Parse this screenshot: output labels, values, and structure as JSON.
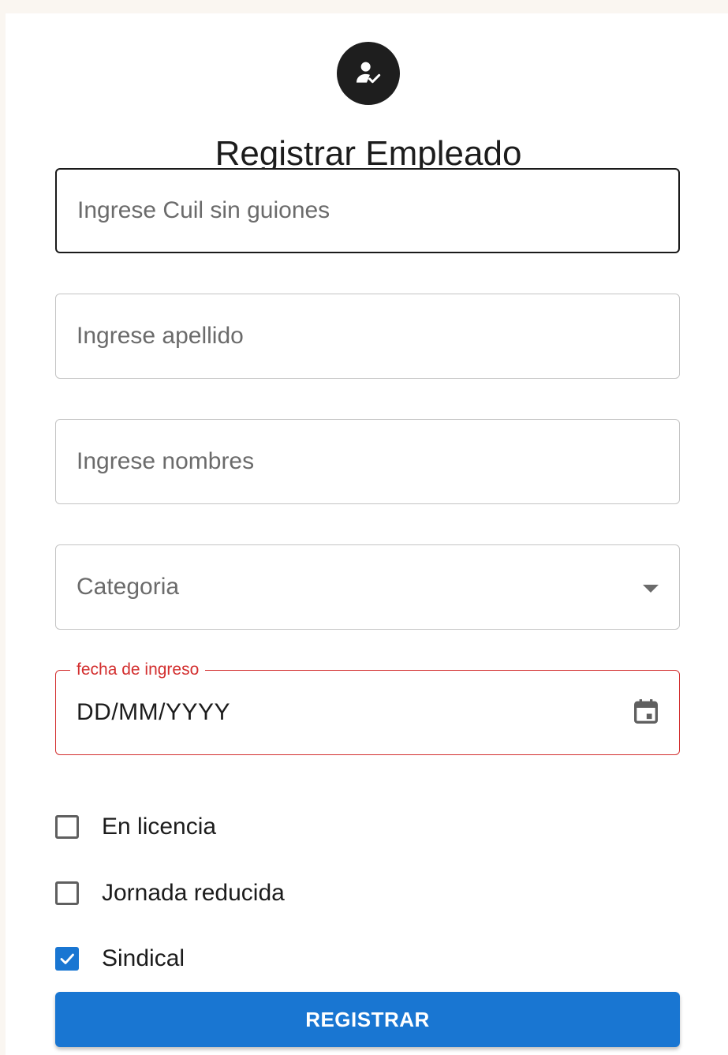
{
  "header": {
    "avatar_icon": "person-check-icon",
    "title": "Registrar Empleado"
  },
  "form": {
    "cuil": {
      "placeholder": "Ingrese Cuil sin guiones",
      "value": ""
    },
    "apellido": {
      "placeholder": "Ingrese apellido",
      "value": ""
    },
    "nombres": {
      "placeholder": "Ingrese nombres",
      "value": ""
    },
    "categoria": {
      "placeholder": "Categoria",
      "icon": "chevron-down-icon"
    },
    "fecha": {
      "label": "fecha de ingreso",
      "value": "DD/MM/YYYY",
      "icon": "calendar-icon"
    },
    "checkboxes": [
      {
        "label": "En licencia",
        "checked": false
      },
      {
        "label": "Jornada reducida",
        "checked": false
      },
      {
        "label": "Sindical",
        "checked": true
      }
    ],
    "submit_label": "REGISTRAR"
  },
  "colors": {
    "primary": "#1976d2",
    "error": "#d32f2f",
    "background": "#faf6f1"
  }
}
